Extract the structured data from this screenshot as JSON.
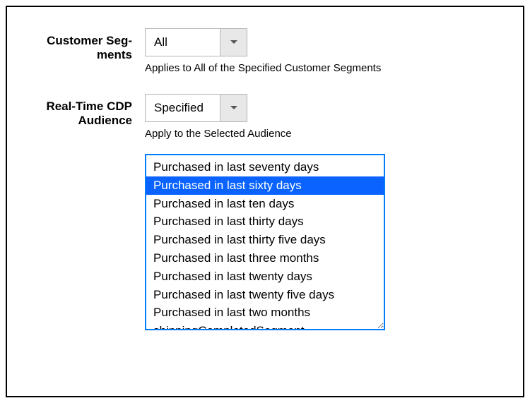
{
  "customerSegments": {
    "label": "Customer Seg­ments",
    "selectValue": "All",
    "helper": "Applies to All of the Specified Customer Segments"
  },
  "rtcdpAudience": {
    "label": "Real-Time CDP Audience",
    "selectValue": "Specified",
    "helper": "Apply to the Selected Audience",
    "selectedIndex": 1,
    "options": [
      "Purchased in last seventy days",
      "Purchased in last sixty days",
      "Purchased in last ten days",
      "Purchased in last thirty days",
      "Purchased in last thirty five days",
      "Purchased in last three months",
      "Purchased in last twenty days",
      "Purchased in last twenty five days",
      "Purchased in last two months",
      "shippingCompletedSegment"
    ]
  }
}
